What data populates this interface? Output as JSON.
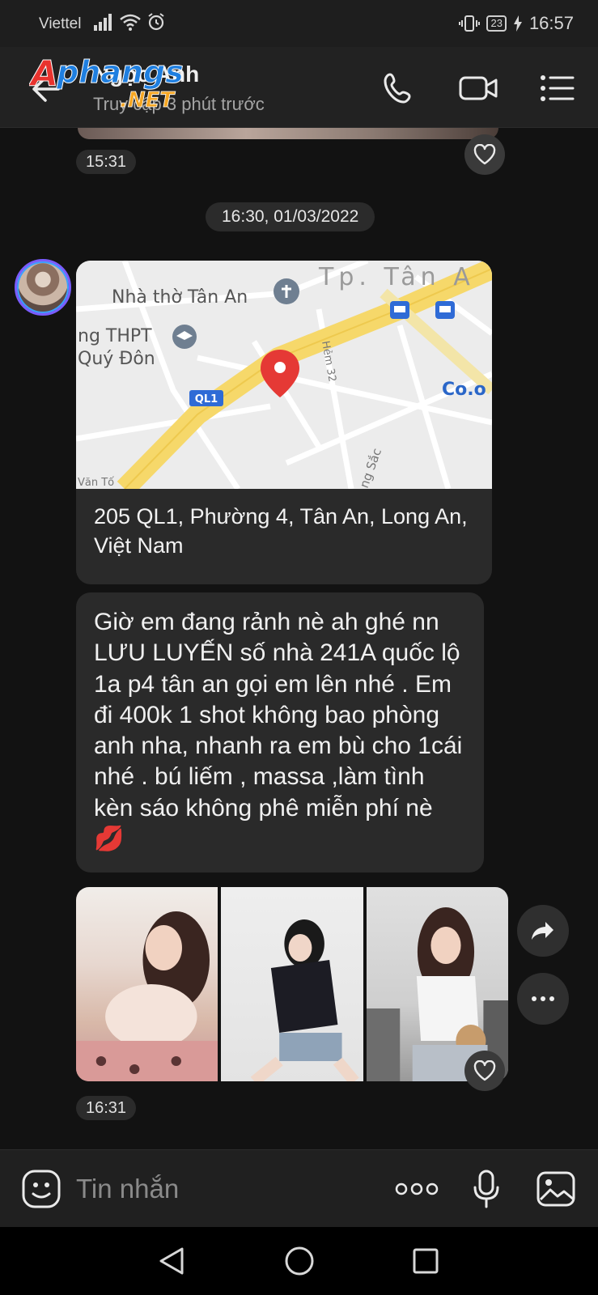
{
  "status_bar": {
    "carrier": "Viettel",
    "battery": "23",
    "time": "16:57"
  },
  "header": {
    "contact_name": "Ngọc Anh",
    "contact_status": "Truy cập 3 phút trước",
    "watermark_logo": "Aphangs .NET",
    "icons": [
      "back-arrow-icon",
      "phone-icon",
      "video-call-icon",
      "menu-icon"
    ]
  },
  "chat": {
    "first_time": "15:31",
    "date_divider": "16:30, 01/03/2022",
    "location": {
      "address": "205 QL1, Phường 4, Tân An, Long An, Việt Nam",
      "map_labels": {
        "church": "Nhà thờ Tân An",
        "city": "Tp. Tân A",
        "school_line1": "ng THPT",
        "school_line2": "Quý Đôn",
        "road": "QL1",
        "alley": "Hẻm 32",
        "street_left": "Văn Tố",
        "street_bottom": "ng Sắc",
        "corner": "Co.o"
      }
    },
    "message_text": "Giờ em đang rảnh nè ah ghé nn LƯU LUYẾN số nhà 241A quốc lộ 1a p4 tân an gọi em lên nhé . Em đi 400k 1 shot không bao phòng anh nha, nhanh ra em bù cho 1cái nhé . bú liếm , massa ,làm tình kèn sáo không phê miễn phí nè 💋",
    "second_time": "16:31"
  },
  "composer": {
    "placeholder": "Tin nhắn"
  },
  "colors": {
    "background": "#121212",
    "bubble": "#2a2a2a",
    "map_pin": "#e53935",
    "road": "#f6d86a"
  }
}
